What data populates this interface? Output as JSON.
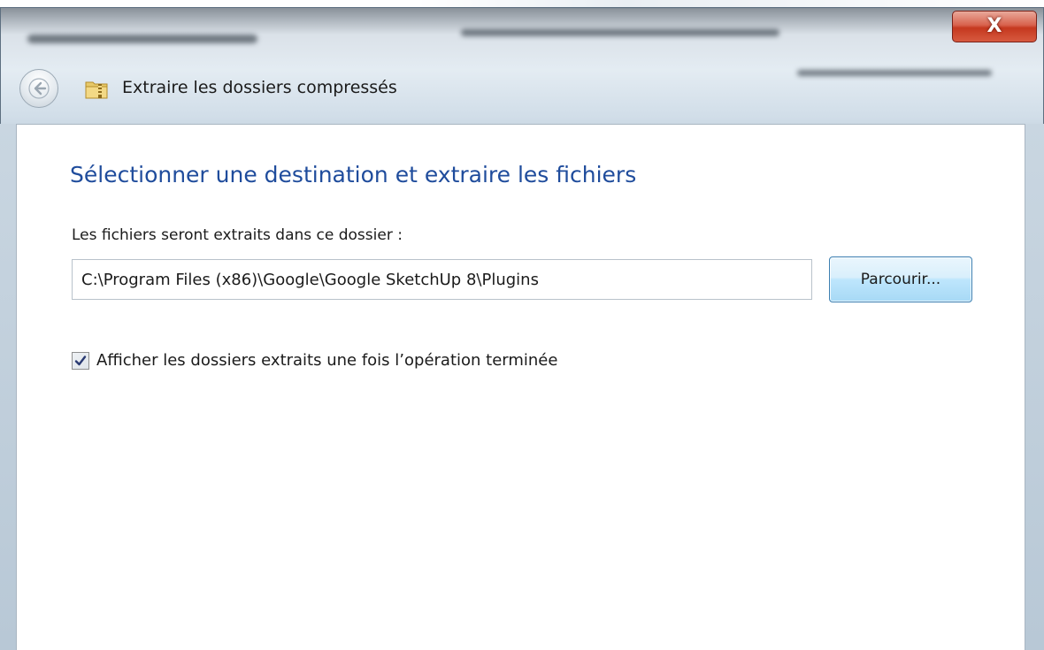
{
  "window": {
    "title": "Extraire les dossiers compressés",
    "close_glyph": "X"
  },
  "icons": {
    "back": "back-arrow-icon",
    "folder": "zip-folder-icon",
    "close": "close-icon",
    "checkmark": "checkmark-icon"
  },
  "colors": {
    "heading": "#1f4c9c",
    "close_button": "#c5381f",
    "button_border": "#3c7fb1"
  },
  "content": {
    "heading": "Sélectionner une destination et extraire les fichiers",
    "destination_label": "Les fichiers seront extraits dans ce dossier :",
    "destination_value": "C:\\Program Files (x86)\\Google\\Google SketchUp 8\\Plugins",
    "browse_label": "Parcourir...",
    "show_extracted_label": "Afficher les dossiers extraits une fois l’opération terminée",
    "show_extracted_checked": true
  }
}
